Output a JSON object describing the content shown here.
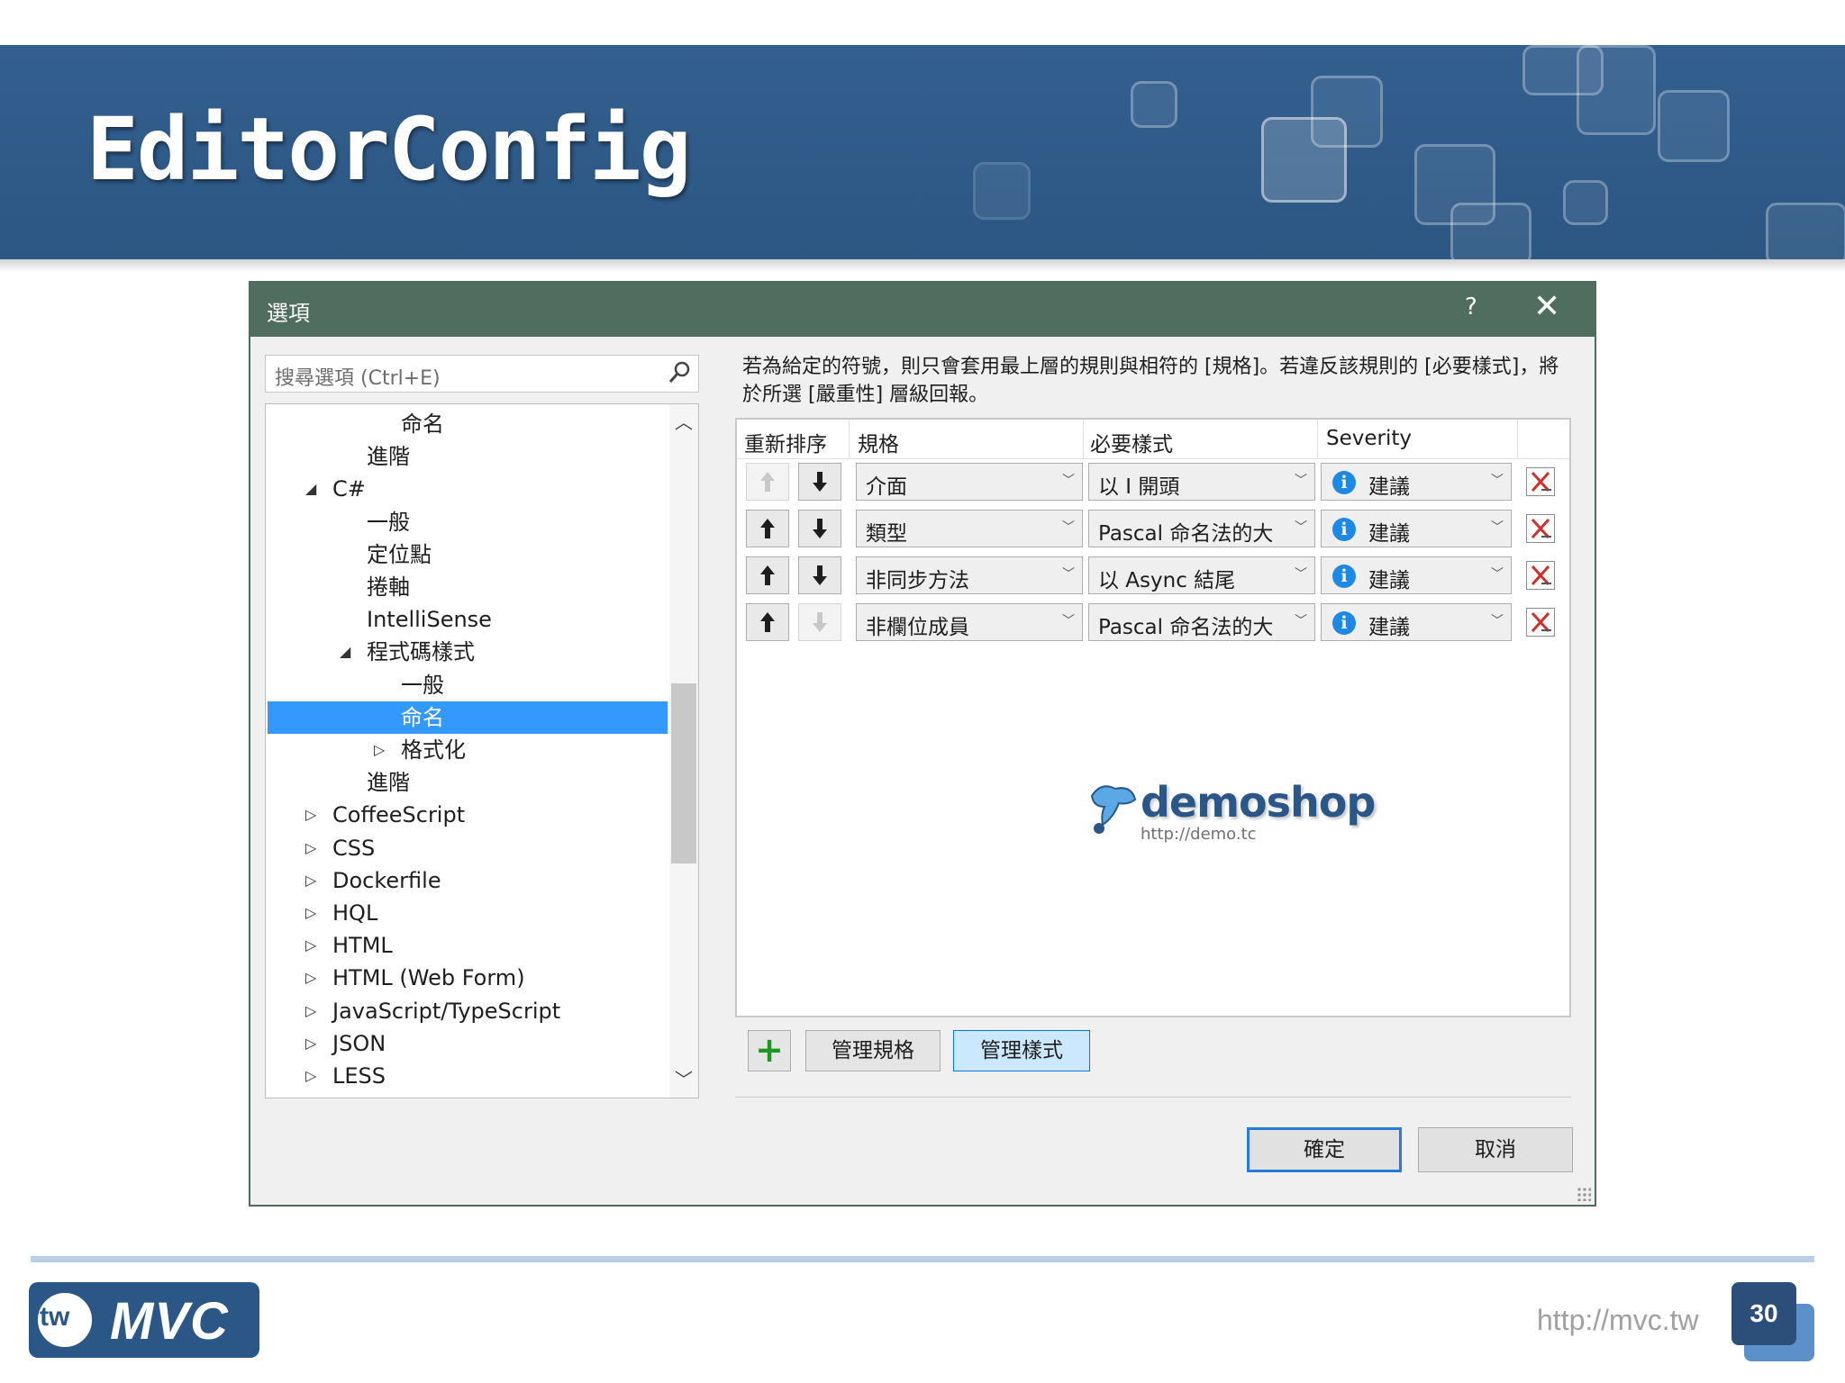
{
  "slide": {
    "title": "EditorConfig",
    "footer_url": "http://mvc.tw",
    "page_number": "30",
    "logo_tw": "tw",
    "logo_mvc": "MVC"
  },
  "dialog": {
    "title": "選項",
    "help_label": "?",
    "close_label": "✕",
    "search_placeholder": "搜尋選項 (Ctrl+E)",
    "description": "若為給定的符號，則只會套用最上層的規則與相符的 [規格]。若違反該規則的 [必要樣式]，將於所選 [嚴重性] 層級回報。",
    "tree": [
      {
        "label": "命名",
        "level": 3,
        "arrow": ""
      },
      {
        "label": "進階",
        "level": 2,
        "arrow": ""
      },
      {
        "label": "C#",
        "level": 1,
        "arrow": "◢"
      },
      {
        "label": "一般",
        "level": 2,
        "arrow": ""
      },
      {
        "label": "定位點",
        "level": 2,
        "arrow": ""
      },
      {
        "label": "捲軸",
        "level": 2,
        "arrow": ""
      },
      {
        "label": "IntelliSense",
        "level": 2,
        "arrow": ""
      },
      {
        "label": "程式碼樣式",
        "level": 2,
        "arrow": "◢"
      },
      {
        "label": "一般",
        "level": 3,
        "arrow": ""
      },
      {
        "label": "命名",
        "level": 3,
        "arrow": "",
        "selected": true
      },
      {
        "label": "格式化",
        "level": 3,
        "arrow": "▷"
      },
      {
        "label": "進階",
        "level": 2,
        "arrow": ""
      },
      {
        "label": "CoffeeScript",
        "level": 1,
        "arrow": "▷"
      },
      {
        "label": "CSS",
        "level": 1,
        "arrow": "▷"
      },
      {
        "label": "Dockerfile",
        "level": 1,
        "arrow": "▷"
      },
      {
        "label": "HQL",
        "level": 1,
        "arrow": "▷"
      },
      {
        "label": "HTML",
        "level": 1,
        "arrow": "▷"
      },
      {
        "label": "HTML (Web Form)",
        "level": 1,
        "arrow": "▷"
      },
      {
        "label": "JavaScript/TypeScript",
        "level": 1,
        "arrow": "▷"
      },
      {
        "label": "JSON",
        "level": 1,
        "arrow": "▷"
      },
      {
        "label": "LESS",
        "level": 1,
        "arrow": "▷"
      }
    ],
    "grid": {
      "headers": {
        "reorder": "重新排序",
        "spec": "規格",
        "style": "必要樣式",
        "severity": "Severity"
      },
      "rows": [
        {
          "up_enabled": false,
          "down_enabled": true,
          "spec": "介面",
          "style": "以 I 開頭",
          "severity": "建議"
        },
        {
          "up_enabled": true,
          "down_enabled": true,
          "spec": "類型",
          "style": "Pascal 命名法的大",
          "severity": "建議"
        },
        {
          "up_enabled": true,
          "down_enabled": true,
          "spec": "非同步方法",
          "style": "以 Async 結尾",
          "severity": "建議"
        },
        {
          "up_enabled": true,
          "down_enabled": false,
          "spec": "非欄位成員",
          "style": "Pascal 命名法的大",
          "severity": "建議"
        }
      ]
    },
    "watermark": {
      "brand": "demoshop",
      "url": "http://demo.tc"
    },
    "buttons": {
      "add": "+",
      "manage_specs": "管理規格",
      "manage_styles": "管理樣式",
      "ok": "確定",
      "cancel": "取消"
    },
    "icons": {
      "up": "arrow-up-icon",
      "down": "arrow-down-icon",
      "info": "info-icon",
      "delete": "delete-icon",
      "search": "search-icon"
    }
  }
}
